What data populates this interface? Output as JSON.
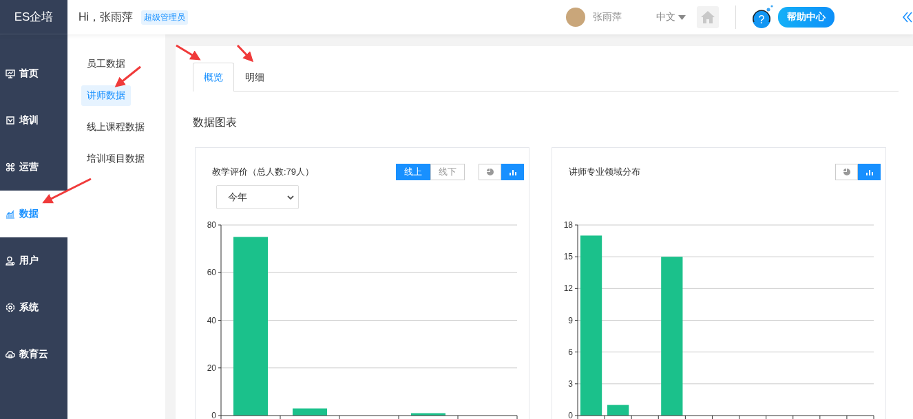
{
  "header": {
    "logo": "ES企培",
    "greeting": "Hi，张雨萍",
    "role_badge": "超级管理员",
    "user_name": "张雨萍",
    "language": "中文",
    "help_icon": "?",
    "help_button": "帮助中心"
  },
  "sidebar": {
    "items": [
      {
        "label": "首页",
        "selected": false
      },
      {
        "label": "培训",
        "selected": false
      },
      {
        "label": "运营",
        "selected": false
      },
      {
        "label": "数据",
        "selected": true
      },
      {
        "label": "用户",
        "selected": false
      },
      {
        "label": "系统",
        "selected": false
      },
      {
        "label": "教育云",
        "selected": false
      }
    ]
  },
  "submenu": {
    "items": [
      {
        "label": "员工数据",
        "selected": false
      },
      {
        "label": "讲师数据",
        "selected": true
      },
      {
        "label": "线上课程数据",
        "selected": false
      },
      {
        "label": "培训项目数据",
        "selected": false
      }
    ]
  },
  "tabs": [
    {
      "label": "概览",
      "selected": true
    },
    {
      "label": "明细",
      "selected": false
    }
  ],
  "section_title": "数据图表",
  "cards": [
    {
      "title": "教学评价（总人数:79人）",
      "mode_toggle": [
        {
          "label": "线上",
          "selected": true
        },
        {
          "label": "线下",
          "selected": false
        }
      ],
      "view_toggle": [
        {
          "kind": "pie",
          "selected": false
        },
        {
          "kind": "bar",
          "selected": true
        }
      ],
      "period_select": "今年",
      "chart_data": {
        "type": "bar",
        "grid": true,
        "series": [
          {
            "color": "#1bc18b",
            "values": [
              75,
              3,
              0,
              1,
              0
            ]
          }
        ],
        "ylim": [
          0,
          80
        ],
        "yticks": [
          0,
          20,
          40,
          60,
          80
        ]
      }
    },
    {
      "title": "讲师专业领域分布",
      "view_toggle": [
        {
          "kind": "pie",
          "selected": false
        },
        {
          "kind": "bar",
          "selected": true
        }
      ],
      "chart_data": {
        "type": "bar",
        "grid": true,
        "series": [
          {
            "color": "#1bc18b",
            "values": [
              17,
              1,
              0,
              15,
              0,
              0,
              0,
              0,
              0,
              0,
              0
            ]
          }
        ],
        "ylim": [
          0,
          18
        ],
        "yticks": [
          0,
          3,
          6,
          9,
          12,
          15,
          18
        ]
      }
    }
  ]
}
